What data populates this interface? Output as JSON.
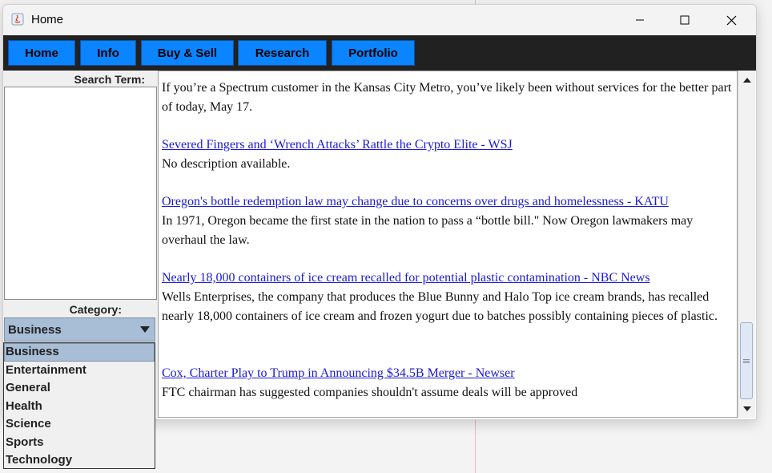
{
  "window": {
    "title": "Home",
    "icon": "java-icon"
  },
  "nav": {
    "items": [
      {
        "label": "Home"
      },
      {
        "label": "Info"
      },
      {
        "label": "Buy & Sell"
      },
      {
        "label": "Research"
      },
      {
        "label": "Portfolio"
      }
    ]
  },
  "sidebar": {
    "search_label": "Search Term:",
    "search_value": "",
    "category_label": "Category:",
    "category_selected": "Business",
    "category_options": [
      "Business",
      "Entertainment",
      "General",
      "Health",
      "Science",
      "Sports",
      "Technology"
    ]
  },
  "articles": [
    {
      "title": "",
      "description": "If you’re a Spectrum customer in the Kansas City Metro, you’ve likely been without services for the better part of today, May 17."
    },
    {
      "title": "Severed Fingers and ‘Wrench Attacks’ Rattle the Crypto Elite - WSJ",
      "description": "No description available."
    },
    {
      "title": "Oregon's bottle redemption law may change due to concerns over drugs and homelessness - KATU",
      "description": "In 1971, Oregon became the first state in the nation to pass a “bottle bill.\" Now Oregon lawmakers may overhaul the law."
    },
    {
      "title": "Nearly 18,000 containers of ice cream recalled for potential plastic contamination - NBC News",
      "description": "Wells Enterprises, the company that produces the Blue Bunny and Halo Top ice cream brands, has recalled nearly 18,000 containers of ice cream and frozen yogurt due to batches possibly containing pieces of plastic."
    },
    {
      "title": "Cox, Charter Play to Trump in Announcing $34.5B Merger - Newser",
      "description": "FTC chairman has suggested companies shouldn't assume deals will be approved"
    }
  ],
  "colors": {
    "nav_button": "#0a84ff",
    "menubar": "#212121",
    "link": "#1a1ad6",
    "selection": "#a8bed6"
  }
}
